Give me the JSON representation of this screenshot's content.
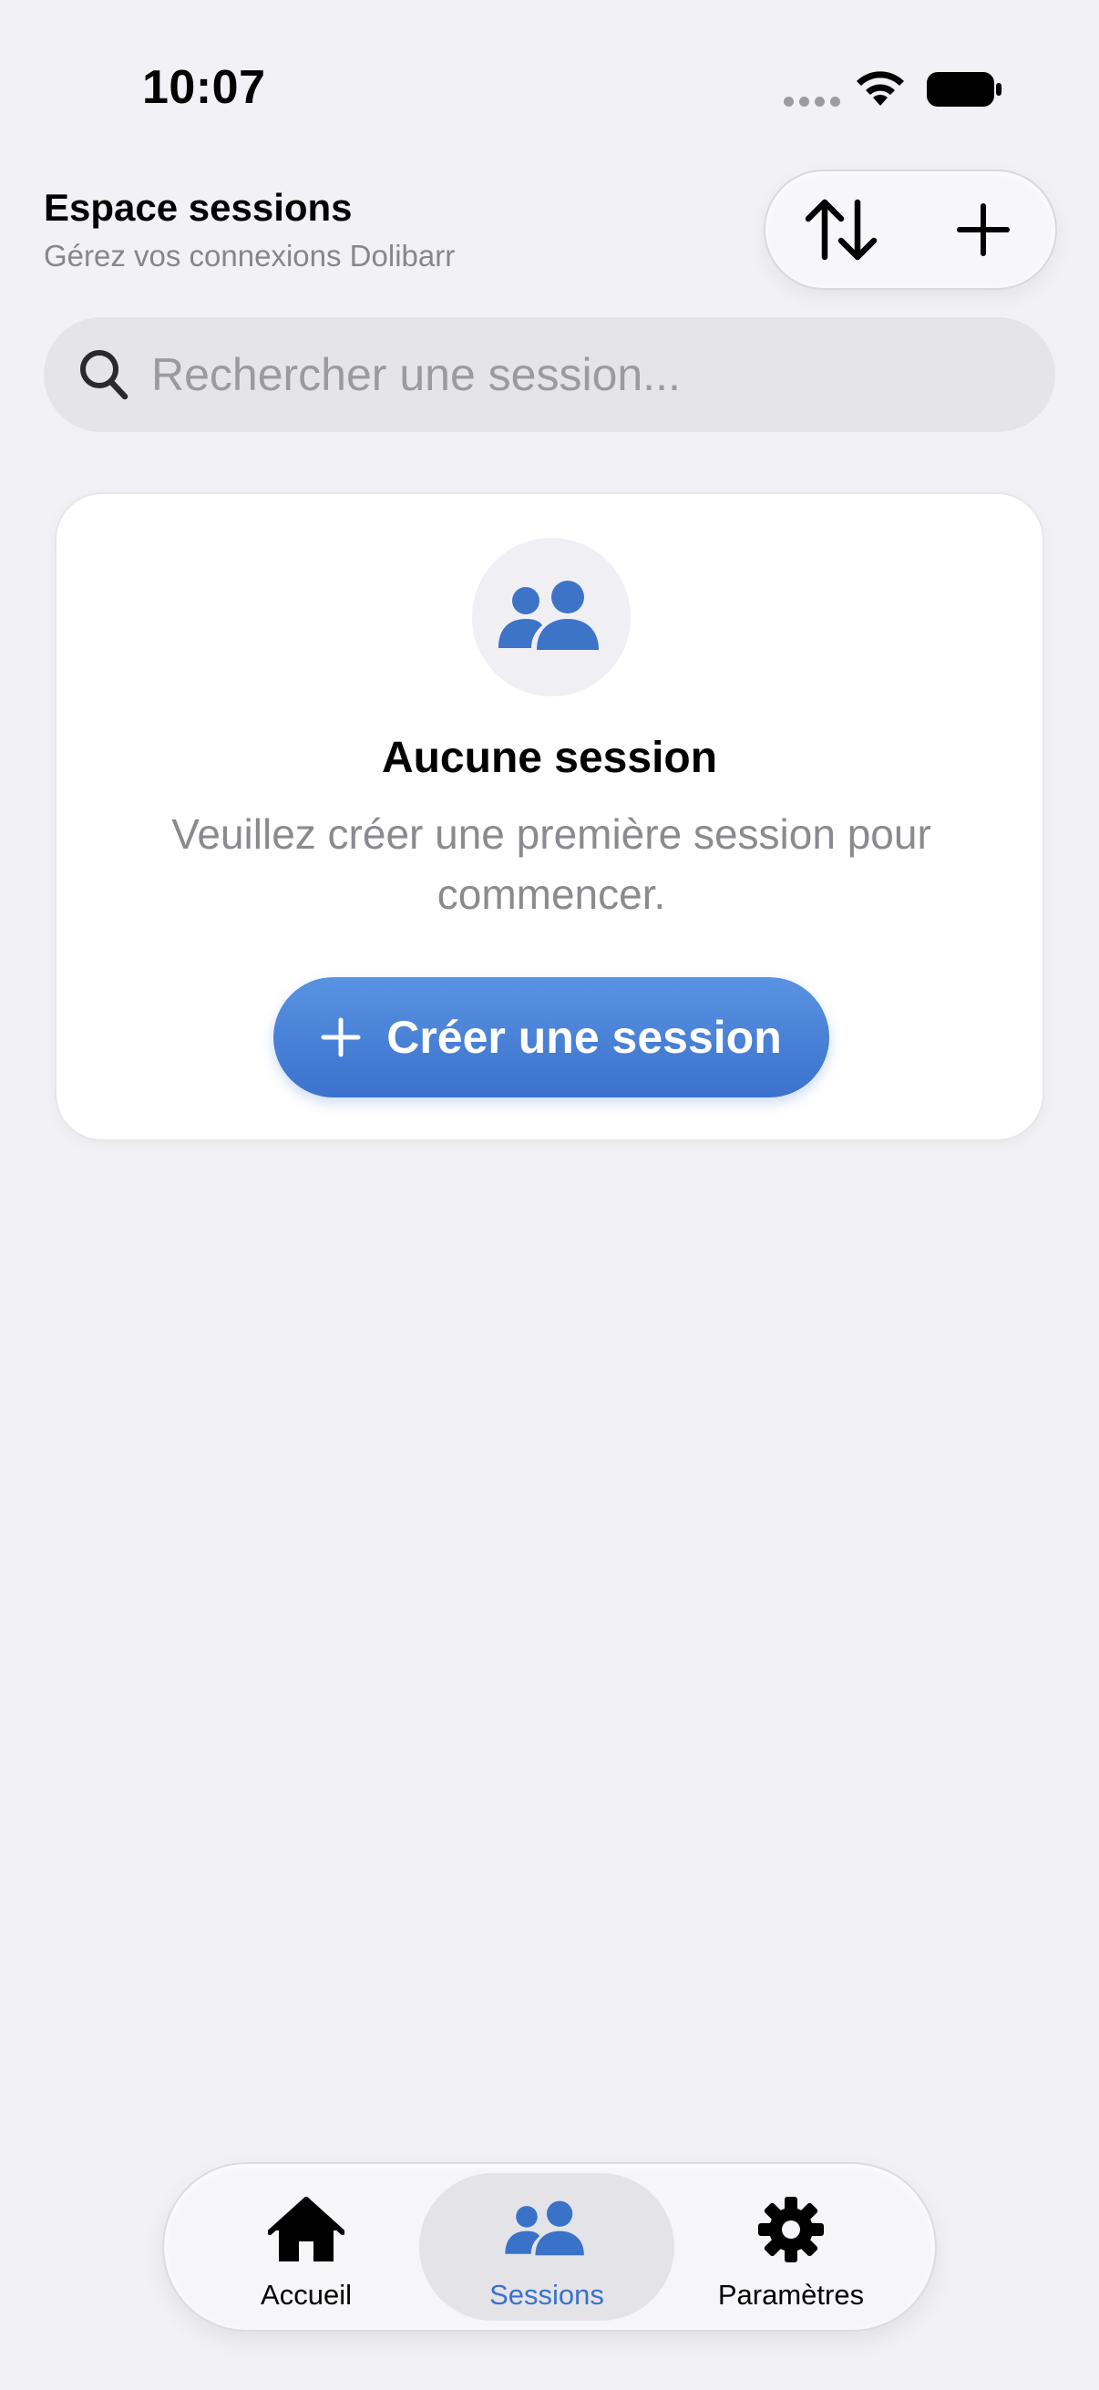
{
  "status_bar": {
    "time": "10:07",
    "icons": [
      "signal-dots-icon",
      "wifi-icon",
      "battery-icon"
    ]
  },
  "header": {
    "title": "Espace sessions",
    "subtitle": "Gérez vos connexions Dolibarr",
    "actions": [
      {
        "icon": "sort-arrows-icon"
      },
      {
        "icon": "plus-icon"
      }
    ]
  },
  "search": {
    "placeholder": "Rechercher une session...",
    "value": "",
    "icon": "search-icon"
  },
  "empty_state": {
    "icon": "people-icon",
    "title": "Aucune session",
    "message": "Veuillez créer une première session pour commencer.",
    "button_label": "Créer une session",
    "button_icon": "plus-icon"
  },
  "tab_bar": {
    "items": [
      {
        "label": "Accueil",
        "icon": "house-icon",
        "active": false
      },
      {
        "label": "Sessions",
        "icon": "people-icon",
        "active": true
      },
      {
        "label": "Paramètres",
        "icon": "gear-icon",
        "active": false
      }
    ]
  },
  "colors": {
    "background": "#f1f1f6",
    "accent": "#3a72c8",
    "button_gradient_top": "#5a92e2",
    "button_gradient_bottom": "#3a72cd",
    "secondary_text": "#86868b"
  }
}
